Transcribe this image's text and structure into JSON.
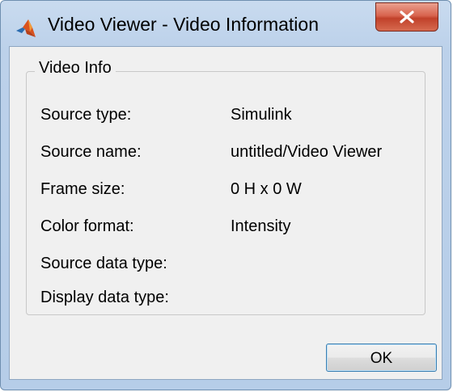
{
  "window": {
    "title": "Video Viewer - Video Information",
    "app_icon": "matlab-logo-icon",
    "close_icon": "close-icon"
  },
  "group": {
    "legend": "Video Info",
    "rows": [
      {
        "label": "Source type:",
        "value": "Simulink"
      },
      {
        "label": "Source name:",
        "value": "untitled/Video Viewer"
      },
      {
        "label": "Frame size:",
        "value": "0 H x 0 W"
      },
      {
        "label": "Color format:",
        "value": "Intensity"
      },
      {
        "label": "Source data type:",
        "value": ""
      },
      {
        "label": "Display data type:",
        "value": ""
      }
    ]
  },
  "buttons": {
    "ok_label": "OK"
  },
  "colors": {
    "titlebar": "#bcd1ea",
    "close_button": "#c1412a",
    "client_background": "#f0f0f0"
  }
}
